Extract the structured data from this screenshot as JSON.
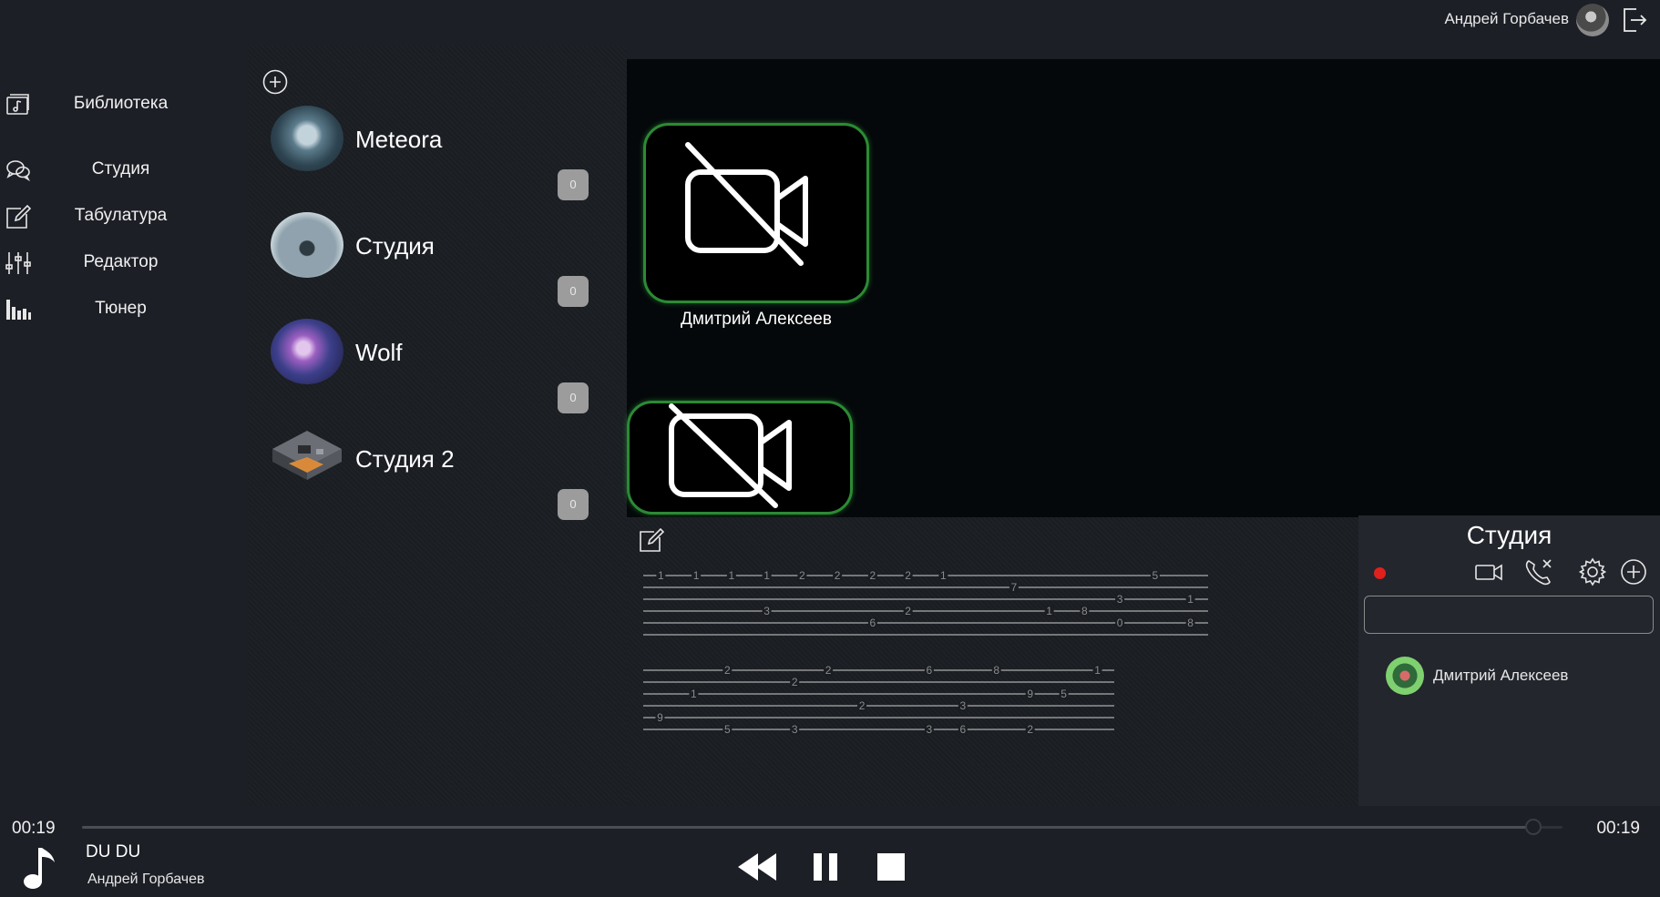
{
  "header": {
    "user_name": "Андрей Горбачев"
  },
  "sidebar": {
    "items": [
      {
        "label": "Библиотека",
        "icon": "library-icon"
      },
      {
        "label": "Студия",
        "icon": "chat-bubbles-icon"
      },
      {
        "label": "Табулатура",
        "icon": "edit-icon"
      },
      {
        "label": "Редактор",
        "icon": "sliders-icon"
      },
      {
        "label": "Тюнер",
        "icon": "equalizer-icon"
      }
    ]
  },
  "rooms": [
    {
      "name": "Meteora",
      "count": "0"
    },
    {
      "name": "Студия",
      "count": "0"
    },
    {
      "name": "Wolf",
      "count": "0"
    },
    {
      "name": "Студия 2",
      "count": "0"
    }
  ],
  "video": {
    "participants": [
      {
        "name": "Дмитрий Алексеев",
        "camera": "off"
      },
      {
        "name": "",
        "camera": "off"
      }
    ]
  },
  "tablature": {
    "lines": [
      [
        [
          "1",
          "1",
          "1",
          "1",
          "2",
          "2",
          "2",
          "2",
          "1",
          "",
          "",
          "",
          "",
          "",
          "5",
          ""
        ],
        [
          "",
          "",
          "",
          "",
          "",
          "",
          "",
          "",
          "",
          "",
          "7",
          "",
          "",
          "",
          "",
          ""
        ],
        [
          "",
          "",
          "",
          "",
          "",
          "",
          "",
          "",
          "",
          "",
          "",
          "",
          "",
          "3",
          "",
          "1"
        ],
        [
          "",
          "",
          "",
          "3",
          "",
          "",
          "",
          "2",
          "",
          "",
          "",
          "1",
          "8",
          "",
          "",
          ""
        ],
        [
          "",
          "",
          "",
          "",
          "",
          "",
          "6",
          "",
          "",
          "",
          "",
          "",
          "",
          "0",
          "",
          "8"
        ],
        [
          "",
          "",
          "",
          "",
          "",
          "",
          "",
          "",
          "",
          "",
          "",
          "",
          "",
          "",
          "",
          ""
        ]
      ],
      [
        [
          "",
          "",
          "2",
          "",
          "",
          "2",
          "",
          "",
          "6",
          "",
          "8",
          "",
          "",
          "1"
        ],
        [
          "",
          "",
          "",
          "",
          "2",
          "",
          "",
          "",
          "",
          "",
          "",
          "",
          "",
          ""
        ],
        [
          "",
          "1",
          "",
          "",
          "",
          "",
          "",
          "",
          "",
          "",
          "",
          "9",
          "5",
          ""
        ],
        [
          "",
          "",
          "",
          "",
          "",
          "",
          "2",
          "",
          "",
          "3",
          "",
          "",
          "",
          ""
        ],
        [
          "9",
          "",
          "",
          "",
          "",
          "",
          "",
          "",
          "",
          "",
          "",
          "",
          "",
          ""
        ],
        [
          "",
          "",
          "5",
          "",
          "3",
          "",
          "",
          "",
          "3",
          "6",
          "",
          "2",
          "",
          ""
        ]
      ]
    ]
  },
  "chat": {
    "title": "Студия",
    "input_value": "",
    "members": [
      {
        "name": "Дмитрий Алексеев"
      }
    ]
  },
  "player": {
    "current_time": "00:19",
    "total_time": "00:19",
    "progress": 0.98,
    "track_title": "DU DU",
    "track_artist": "Андрей Горбачев"
  },
  "colors": {
    "accent_green": "#2c8a34",
    "record_red": "#e0201d",
    "badge_gray": "#9c9c9c"
  }
}
